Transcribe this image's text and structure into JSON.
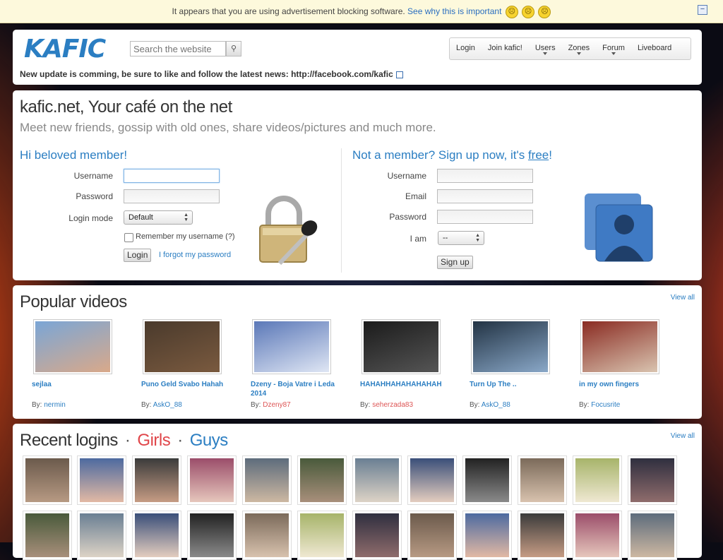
{
  "notice": {
    "text": "It appears that you are using advertisement blocking software.",
    "link": "See why this is important"
  },
  "header": {
    "logo": "KAFIC",
    "search_placeholder": "Search the website",
    "nav": [
      {
        "label": "Login",
        "dropdown": false
      },
      {
        "label": "Join kafic!",
        "dropdown": false
      },
      {
        "label": "Users",
        "dropdown": true
      },
      {
        "label": "Zones",
        "dropdown": true
      },
      {
        "label": "Forum",
        "dropdown": true
      },
      {
        "label": "Liveboard",
        "dropdown": false
      }
    ],
    "news": "New update is comming, be sure to like and follow the latest news: http://facebook.com/kafic"
  },
  "welcome": {
    "title": "kafic.net, Your café on the net",
    "subtitle": "Meet new friends, gossip with old ones, share videos/pictures and much more.",
    "login": {
      "heading": "Hi beloved member!",
      "username_label": "Username",
      "password_label": "Password",
      "mode_label": "Login mode",
      "mode_value": "Default",
      "remember_label": "Remember my username (?)",
      "login_button": "Login",
      "forgot_link": "I forgot my password"
    },
    "signup": {
      "heading_pre": "Not a member? Sign up now, it's ",
      "heading_link": "free",
      "heading_post": "!",
      "username_label": "Username",
      "email_label": "Email",
      "password_label": "Password",
      "iam_label": "I am",
      "iam_value": "--",
      "signup_button": "Sign up"
    }
  },
  "videos": {
    "heading": "Popular videos",
    "view_all": "View all",
    "by_label": "By:",
    "items": [
      {
        "title": "sejlaa",
        "user": "nermin",
        "female": false,
        "colors": [
          "#7aa6d6",
          "#d9a98a"
        ]
      },
      {
        "title": "Puno Geld Svabo Hahah",
        "user": "AskO_88",
        "female": false,
        "colors": [
          "#4a3a2c",
          "#7a5a3f"
        ]
      },
      {
        "title": "Dzeny - Boja Vatre i Leda 2014",
        "user": "Dzeny87",
        "female": true,
        "colors": [
          "#5b78b8",
          "#dfe6f4"
        ]
      },
      {
        "title": "HAHAHHAHAHAHAHAH",
        "user": "seherzada83",
        "female": true,
        "colors": [
          "#1b1b1b",
          "#555"
        ]
      },
      {
        "title": "Turn Up The ..",
        "user": "AskO_88",
        "female": false,
        "colors": [
          "#223344",
          "#8aa8c8"
        ]
      },
      {
        "title": "in my own fingers",
        "user": "Focusrite",
        "female": false,
        "colors": [
          "#8a2b22",
          "#d9c4b0"
        ]
      }
    ]
  },
  "logins": {
    "heading": "Recent logins",
    "dot": "·",
    "girls": "Girls",
    "guys": "Guys",
    "view_all": "View all"
  }
}
